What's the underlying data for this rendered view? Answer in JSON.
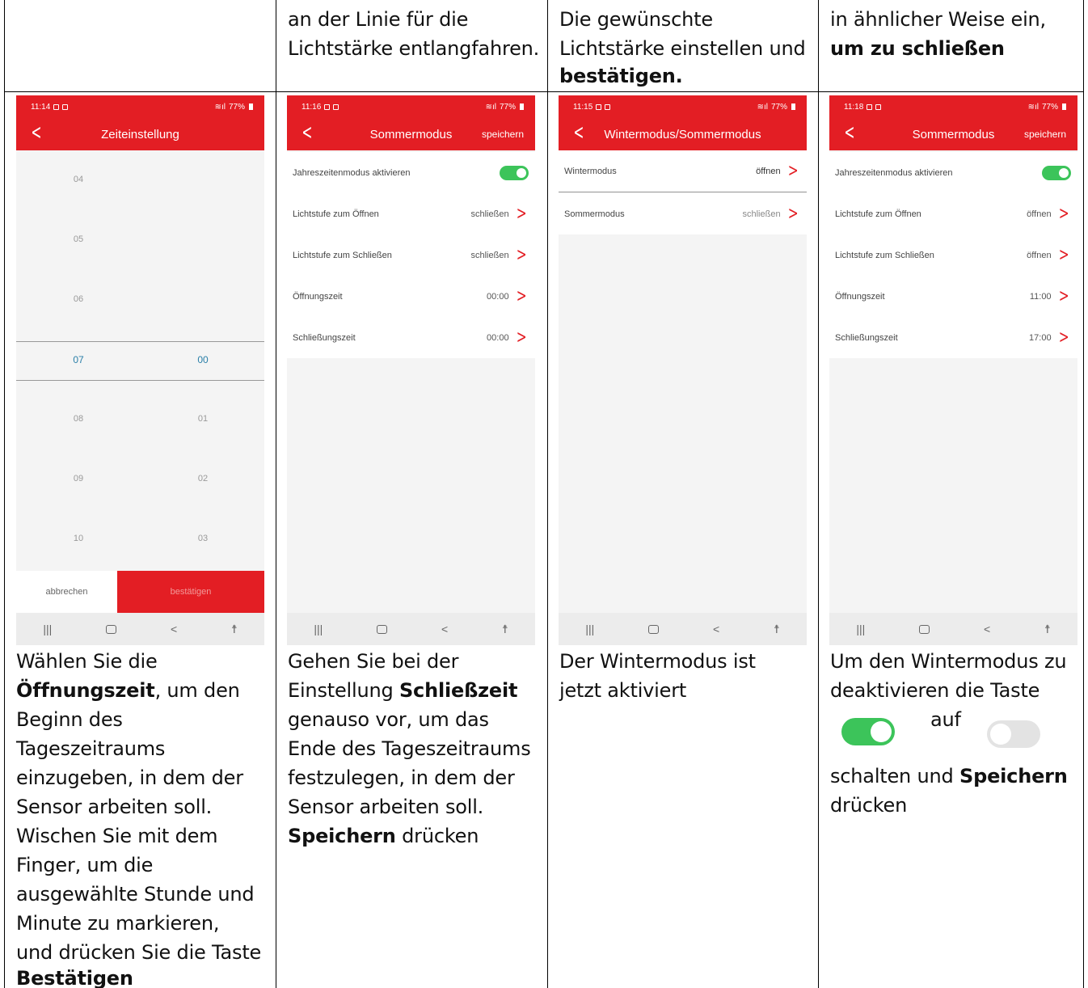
{
  "top_row": {
    "c2": [
      "an der Linie für die",
      "Lichtstärke entlangfahren."
    ],
    "c3": [
      "Die gewünschte",
      "Lichtstärke einstellen und",
      "bestätigen."
    ],
    "c4": [
      "in ähnlicher Weise ein,",
      "um zu schließen"
    ]
  },
  "phone1": {
    "time": "11:14",
    "battery": "77%",
    "title": "Zeiteinstellung",
    "hours": [
      "04",
      "05",
      "06",
      "07",
      "08",
      "09",
      "10"
    ],
    "minutes": [
      "00",
      "01",
      "02",
      "03"
    ],
    "cancel": "abbrechen",
    "confirm": "bestätigen"
  },
  "phone2": {
    "time": "11:16",
    "battery": "77%",
    "title": "Sommermodus",
    "save": "speichern",
    "rows": [
      {
        "label": "Jahreszeitenmodus aktivieren",
        "value": ""
      },
      {
        "label": "Lichtstufe zum Öffnen",
        "value": "schließen"
      },
      {
        "label": "Lichtstufe zum Schließen",
        "value": "schließen"
      },
      {
        "label": "Öffnungszeit",
        "value": "00:00"
      },
      {
        "label": "Schließungszeit",
        "value": "00:00"
      }
    ]
  },
  "phone3": {
    "time": "11:15",
    "battery": "77%",
    "title": "Wintermodus/Sommermodus",
    "rows": [
      {
        "label": "Wintermodus",
        "value": "öffnen"
      },
      {
        "label": "Sommermodus",
        "value": "schließen"
      }
    ]
  },
  "phone4": {
    "time": "11:18",
    "battery": "77%",
    "title": "Sommermodus",
    "save": "speichern",
    "rows": [
      {
        "label": "Jahreszeitenmodus aktivieren",
        "value": ""
      },
      {
        "label": "Lichtstufe zum Öffnen",
        "value": "öffnen"
      },
      {
        "label": "Lichtstufe zum Schließen",
        "value": "öffnen"
      },
      {
        "label": "Öffnungszeit",
        "value": "11:00"
      },
      {
        "label": "Schließungszeit",
        "value": "17:00"
      }
    ]
  },
  "bottom_row": {
    "c1": {
      "l1": "Wählen Sie die",
      "l2b": "Öffnungszeit",
      "l2": ", um den",
      "l3": "Beginn des",
      "l4": "Tageszeitraums",
      "l5": "einzugeben, in dem der",
      "l6": "Sensor arbeiten soll.",
      "l7": "Wischen Sie mit dem",
      "l8": "Finger, um die",
      "l9": "ausgewählte Stunde und",
      "l10": "Minute zu markieren,",
      "l11": "und drücken Sie die Taste",
      "l12b": "Bestätigen"
    },
    "c2": {
      "l1": "Gehen Sie bei der",
      "l2": "Einstellung ",
      "l2b": "Schließzeit",
      "l3": "genauso vor, um das",
      "l4": "Ende des Tageszeitraums",
      "l5": "festzulegen, in dem der",
      "l6": "Sensor arbeiten soll.",
      "l7b": "Speichern",
      "l7": " drücken"
    },
    "c3": {
      "l1": "Der Wintermodus ist",
      "l2": "jetzt aktiviert"
    },
    "c4": {
      "l1": "Um den Wintermodus zu",
      "l2": "deaktivieren die Taste",
      "mid": "auf",
      "l3": "schalten und ",
      "l3b": "Speichern",
      "l4": "drücken"
    }
  }
}
